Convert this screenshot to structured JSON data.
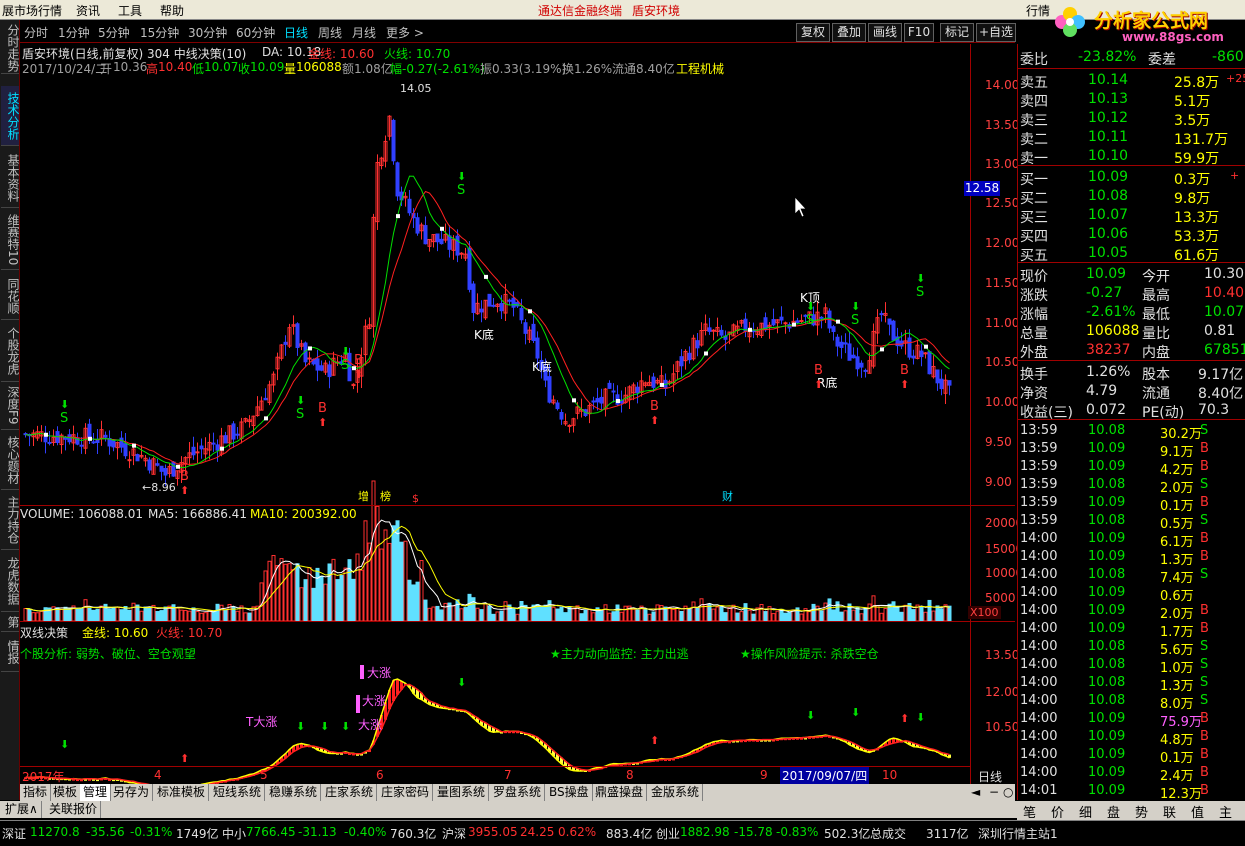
{
  "menubar": {
    "items": [
      "展市场行情",
      "资讯",
      "工具",
      "帮助"
    ],
    "center_links": [
      "通达信金融终端",
      "盾安环境"
    ],
    "right_tab": "行情"
  },
  "logo": {
    "name": "分析家公式网",
    "url": "www.88gs.com"
  },
  "periods": [
    "分时",
    "1分钟",
    "5分钟",
    "15分钟",
    "30分钟",
    "60分钟",
    "日线",
    "周线",
    "月线",
    "更多 >"
  ],
  "selected_period": "日线",
  "right_buttons": [
    "复权",
    "叠加",
    "画线",
    "F10",
    "标记",
    "+自选"
  ],
  "left_tabs": [
    "分时走势",
    "技术分析",
    "基本资料",
    "维赛特10",
    "同花顺",
    "个股龙虎",
    "深度F9",
    "核心题材",
    "主力持仓",
    "龙虎数据",
    "第",
    "情报"
  ],
  "selected_left_tab": "技术分析",
  "header": {
    "line1_title": "盾安环境(日线,前复权) 304 中线决策(10)",
    "da": "DA: 10.18",
    "jinxian": "金线: 10.60",
    "huoxian": "火线: 10.70",
    "date": "2017/10/24/二",
    "open_lbl": "开",
    "open": "10.36",
    "high_lbl": "高",
    "high": "10.40",
    "low_lbl": "低",
    "low": "10.07",
    "close_lbl": "收",
    "close": "10.09",
    "vol_lbl": "量",
    "vol": "106088",
    "amount_lbl": "额",
    "amount": "1.08亿",
    "change": "幅-0.27(-2.61%)",
    "swing": "振0.33(3.19%)",
    "turnover": "换1.26%",
    "float": "流通8.40亿",
    "industry": "工程机械"
  },
  "price_axis": [
    "14.00",
    "13.50",
    "13.00",
    "12.50",
    "12.00",
    "11.50",
    "11.00",
    "10.50",
    "10.00",
    "9.50",
    "9.00"
  ],
  "current_price_tag": "12.58",
  "price_annotations": {
    "high_mark": "14.05",
    "low_mark": "8.96",
    "labels": [
      "K底",
      "K底",
      "K顶",
      "R底"
    ],
    "s_label": "S",
    "b_label": "B",
    "event_tags": [
      "增",
      "榜",
      "$",
      "财"
    ]
  },
  "volume": {
    "vol": "VOLUME: 106088.01",
    "ma5": "MA5: 166886.41",
    "ma10": "MA10: 200392.00",
    "axis": [
      "20000",
      "15000",
      "10000",
      "5000"
    ],
    "multiplier": "X100"
  },
  "decision": {
    "title": "双线决策",
    "jinxian": "金线: 10.60",
    "huoxian": "火线: 10.70",
    "analysis": "个股分析: 弱势、破位、空仓观望",
    "monitor": "★主力动向监控: 主力出逃",
    "risk": "★操作风险提示: 杀跌空仓",
    "axis": [
      "13.50",
      "12.00",
      "10.50"
    ],
    "dazhang": "大涨",
    "t_dazhang": "T大涨"
  },
  "time_axis": {
    "labels": [
      "2017年",
      "4",
      "5",
      "6",
      "7",
      "8",
      "9",
      "10"
    ],
    "cursor_date": "2017/09/07/四",
    "period_label": "日线"
  },
  "bottom_tabs": [
    "指标",
    "模板",
    "管理",
    "另存为",
    "标准模板",
    "短线系统",
    "稳赚系统",
    "庄家系统",
    "庄家密码",
    "量图系统",
    "罗盘系统",
    "BS操盘",
    "鼎盛操盘",
    "金版系统"
  ],
  "selected_bottom_tab": "管理",
  "ext_tabs": [
    "扩展∧",
    "关联报价"
  ],
  "quote": {
    "weibi_lbl": "委比",
    "weibi": "-23.82%",
    "weicha_lbl": "委差",
    "weicha": "-860",
    "sells": [
      {
        "lbl": "卖五",
        "price": "10.14",
        "vol": "25.8万",
        "chg": "+25"
      },
      {
        "lbl": "卖四",
        "price": "10.13",
        "vol": "5.1万",
        "chg": ""
      },
      {
        "lbl": "卖三",
        "price": "10.12",
        "vol": "3.5万",
        "chg": ""
      },
      {
        "lbl": "卖二",
        "price": "10.11",
        "vol": "131.7万",
        "chg": ""
      },
      {
        "lbl": "卖一",
        "price": "10.10",
        "vol": "59.9万",
        "chg": ""
      }
    ],
    "buys": [
      {
        "lbl": "买一",
        "price": "10.09",
        "vol": "0.3万",
        "chg": "+"
      },
      {
        "lbl": "买二",
        "price": "10.08",
        "vol": "9.8万",
        "chg": ""
      },
      {
        "lbl": "买三",
        "price": "10.07",
        "vol": "13.3万",
        "chg": ""
      },
      {
        "lbl": "买四",
        "price": "10.06",
        "vol": "53.3万",
        "chg": ""
      },
      {
        "lbl": "买五",
        "price": "10.05",
        "vol": "61.6万",
        "chg": ""
      }
    ],
    "stats": [
      {
        "l1": "现价",
        "v1": "10.09",
        "l2": "今开",
        "v2": "10.30"
      },
      {
        "l1": "涨跌",
        "v1": "-0.27",
        "l2": "最高",
        "v2": "10.40"
      },
      {
        "l1": "涨幅",
        "v1": "-2.61%",
        "l2": "最低",
        "v2": "10.07"
      },
      {
        "l1": "总量",
        "v1": "106088",
        "l2": "量比",
        "v2": "0.81"
      },
      {
        "l1": "外盘",
        "v1": "38237",
        "l2": "内盘",
        "v2": "67851"
      }
    ],
    "stats2": [
      {
        "l1": "换手",
        "v1": "1.26%",
        "l2": "股本",
        "v2": "9.17亿"
      },
      {
        "l1": "净资",
        "v1": "4.79",
        "l2": "流通",
        "v2": "8.40亿"
      },
      {
        "l1": "收益(三)",
        "v1": "0.072",
        "l2": "PE(动)",
        "v2": "70.3"
      }
    ],
    "ticks": [
      {
        "t": "13:59",
        "p": "10.08",
        "v": "30.2万",
        "d": "S"
      },
      {
        "t": "13:59",
        "p": "10.09",
        "v": "9.1万",
        "d": "B"
      },
      {
        "t": "13:59",
        "p": "10.09",
        "v": "4.2万",
        "d": "B"
      },
      {
        "t": "13:59",
        "p": "10.08",
        "v": "2.0万",
        "d": "S"
      },
      {
        "t": "13:59",
        "p": "10.09",
        "v": "0.1万",
        "d": "B"
      },
      {
        "t": "13:59",
        "p": "10.08",
        "v": "0.5万",
        "d": "S"
      },
      {
        "t": "14:00",
        "p": "10.09",
        "v": "6.1万",
        "d": "B"
      },
      {
        "t": "14:00",
        "p": "10.09",
        "v": "1.3万",
        "d": "B"
      },
      {
        "t": "14:00",
        "p": "10.08",
        "v": "7.4万",
        "d": "S"
      },
      {
        "t": "14:00",
        "p": "10.09",
        "v": "0.6万",
        "d": ""
      },
      {
        "t": "14:00",
        "p": "10.09",
        "v": "2.0万",
        "d": "B"
      },
      {
        "t": "14:00",
        "p": "10.09",
        "v": "1.7万",
        "d": "B"
      },
      {
        "t": "14:00",
        "p": "10.08",
        "v": "5.6万",
        "d": "S"
      },
      {
        "t": "14:00",
        "p": "10.08",
        "v": "1.0万",
        "d": "S"
      },
      {
        "t": "14:00",
        "p": "10.08",
        "v": "1.3万",
        "d": "S"
      },
      {
        "t": "14:00",
        "p": "10.08",
        "v": "8.0万",
        "d": "S"
      },
      {
        "t": "14:00",
        "p": "10.09",
        "v": "75.9万",
        "d": "B"
      },
      {
        "t": "14:00",
        "p": "10.09",
        "v": "4.8万",
        "d": "B"
      },
      {
        "t": "14:00",
        "p": "10.09",
        "v": "0.1万",
        "d": "B"
      },
      {
        "t": "14:00",
        "p": "10.09",
        "v": "2.4万",
        "d": "B"
      },
      {
        "t": "14:01",
        "p": "10.09",
        "v": "12.3万",
        "d": "B"
      }
    ]
  },
  "quote_tabs": [
    "笔",
    "价",
    "细",
    "盘",
    "势",
    "联",
    "值",
    "主"
  ],
  "statusbar": {
    "sh_lbl": "深证",
    "sh_val": "11270.8",
    "sh_chg": "-35.56",
    "sh_pct": "-0.31%",
    "sh_amt": "1749亿",
    "zx_lbl": "中小",
    "zx_val": "7766.45",
    "zx_chg": "-31.13",
    "zx_pct": "-0.40%",
    "zx_amt": "760.3亿",
    "hs_lbl": "沪深",
    "hs_val": "3955.05",
    "hs_chg": "24.25",
    "hs_pct": "0.62%",
    "hs_amt": "883.4亿",
    "cy_lbl": "创业",
    "cy_val": "1882.98",
    "cy_chg": "-15.78",
    "cy_pct": "-0.83%",
    "cy_amt": "502.3亿",
    "zcj_lbl": "总成交",
    "zcj_val": "3117亿",
    "station": "深圳行情主站1"
  },
  "colors": {
    "up": "#ff3030",
    "down": "#0000ff",
    "bg": "#000000",
    "ma_red": "#ff2020",
    "ma_green": "#00e000"
  }
}
